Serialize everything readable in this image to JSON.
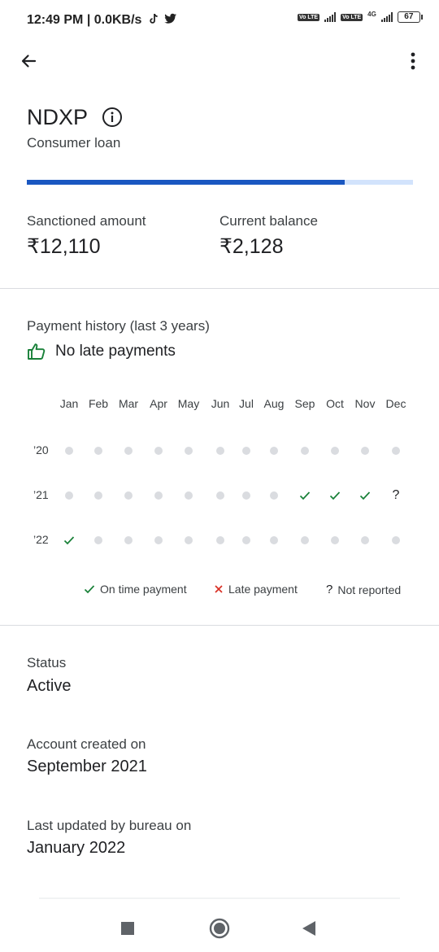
{
  "status_bar": {
    "time": "12:49 PM | 0.0KB/s",
    "battery": "67",
    "network_badge": "Vo LTE",
    "network_type": "4G"
  },
  "account": {
    "name": "NDXP",
    "type": "Consumer loan",
    "sanctioned_label": "Sanctioned amount",
    "sanctioned_value": "₹12,110",
    "balance_label": "Current balance",
    "balance_value": "₹2,128",
    "repaid_fraction": 0.824
  },
  "payment_history": {
    "label": "Payment history (last 3 years)",
    "summary": "No late payments",
    "months": [
      "Jan",
      "Feb",
      "Mar",
      "Apr",
      "May",
      "Jun",
      "Jul",
      "Aug",
      "Sep",
      "Oct",
      "Nov",
      "Dec"
    ],
    "years": [
      {
        "label": "’20",
        "statuses": [
          "none",
          "none",
          "none",
          "none",
          "none",
          "none",
          "none",
          "none",
          "none",
          "none",
          "none",
          "none"
        ]
      },
      {
        "label": "’21",
        "statuses": [
          "none",
          "none",
          "none",
          "none",
          "none",
          "none",
          "none",
          "none",
          "ontime",
          "ontime",
          "ontime",
          "notreported"
        ]
      },
      {
        "label": "’22",
        "statuses": [
          "ontime",
          "none",
          "none",
          "none",
          "none",
          "none",
          "none",
          "none",
          "none",
          "none",
          "none",
          "none"
        ]
      }
    ],
    "legend": {
      "ontime": "On time payment",
      "late": "Late payment",
      "notreported": "Not reported"
    }
  },
  "details": {
    "status_label": "Status",
    "status_value": "Active",
    "created_label": "Account created on",
    "created_value": "September 2021",
    "updated_label": "Last updated by bureau on",
    "updated_value": "January 2022"
  },
  "colors": {
    "progress_fill": "#1a57c1",
    "progress_track": "#d2e3fc",
    "ontime_green": "#188038",
    "late_red": "#d93025",
    "empty_dot": "#dadce0"
  }
}
